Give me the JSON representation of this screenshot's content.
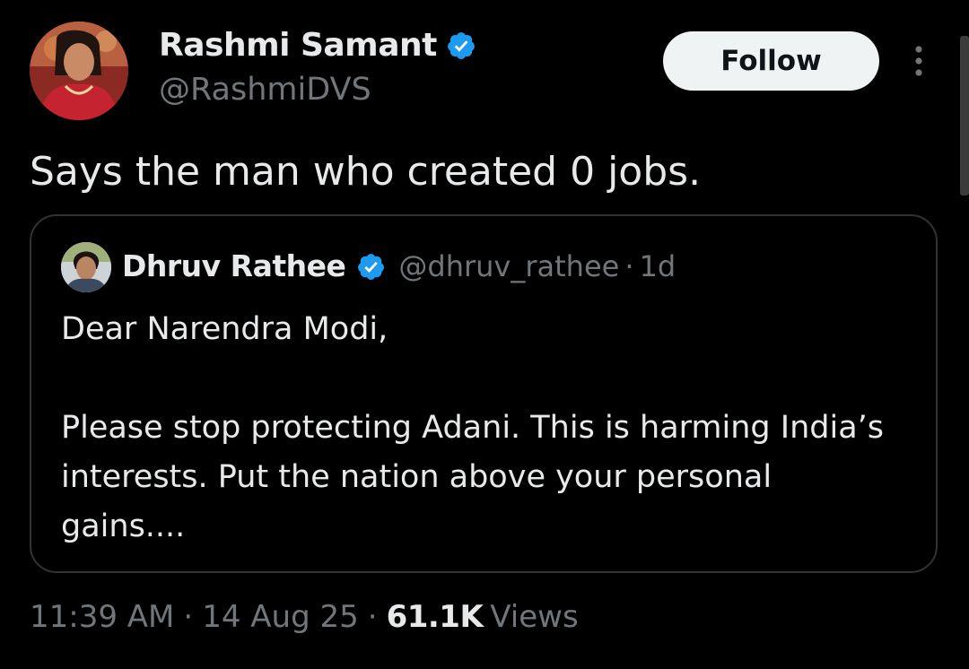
{
  "tweet": {
    "author": {
      "name": "Rashmi Samant",
      "handle": "@RashmiDVS",
      "verified": true
    },
    "follow_label": "Follow",
    "text": "Says the man who created 0 jobs.",
    "quoted": {
      "author": {
        "name": "Dhruv Rathee",
        "handle": "@dhruv_rathee",
        "verified": true
      },
      "separator": "·",
      "time": "1d",
      "paragraphs": [
        "Dear Narendra Modi,",
        "Please stop protecting Adani. This is harming India’s interests. Put the nation above your personal gains...."
      ]
    },
    "meta": {
      "time": "11:39 AM",
      "date": "14 Aug 25",
      "separator": "·",
      "views_count": "61.1K",
      "views_label": "Views"
    }
  },
  "icons": {
    "verified": "verified-badge-icon",
    "more": "more-vertical-icon"
  },
  "colors": {
    "background": "#000000",
    "text_primary": "#e7e9ea",
    "text_secondary": "#71767b",
    "verified_blue": "#1d9bf0",
    "border": "#2f3336",
    "follow_bg": "#eff3f4"
  }
}
